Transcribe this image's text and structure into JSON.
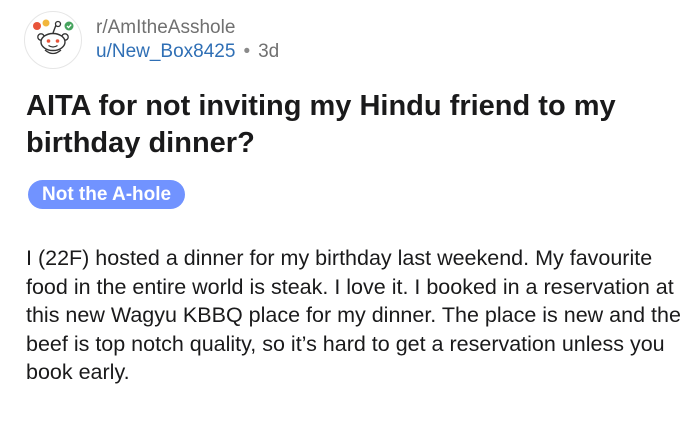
{
  "post": {
    "subreddit": "r/AmItheAsshole",
    "username": "u/New_Box8425",
    "separator": "•",
    "age": "3d",
    "title": "AITA for not inviting my Hindu friend to my birthday dinner?",
    "flair": "Not the A-hole",
    "body": "I (22F) hosted a dinner for my birthday last weekend. My favourite food in the entire world is steak. I love it. I booked in a reservation at this new Wagyu KBBQ place for my dinner. The place is new and the beef is top notch quality, so it’s hard to get a reservation unless you book early."
  },
  "colors": {
    "flair_bg": "#7193ff",
    "username": "#2f6fb5",
    "subreddit": "#707070",
    "text": "#1a1a1b"
  },
  "icons": {
    "avatar": "reddit-snoo-avatar-icon"
  }
}
